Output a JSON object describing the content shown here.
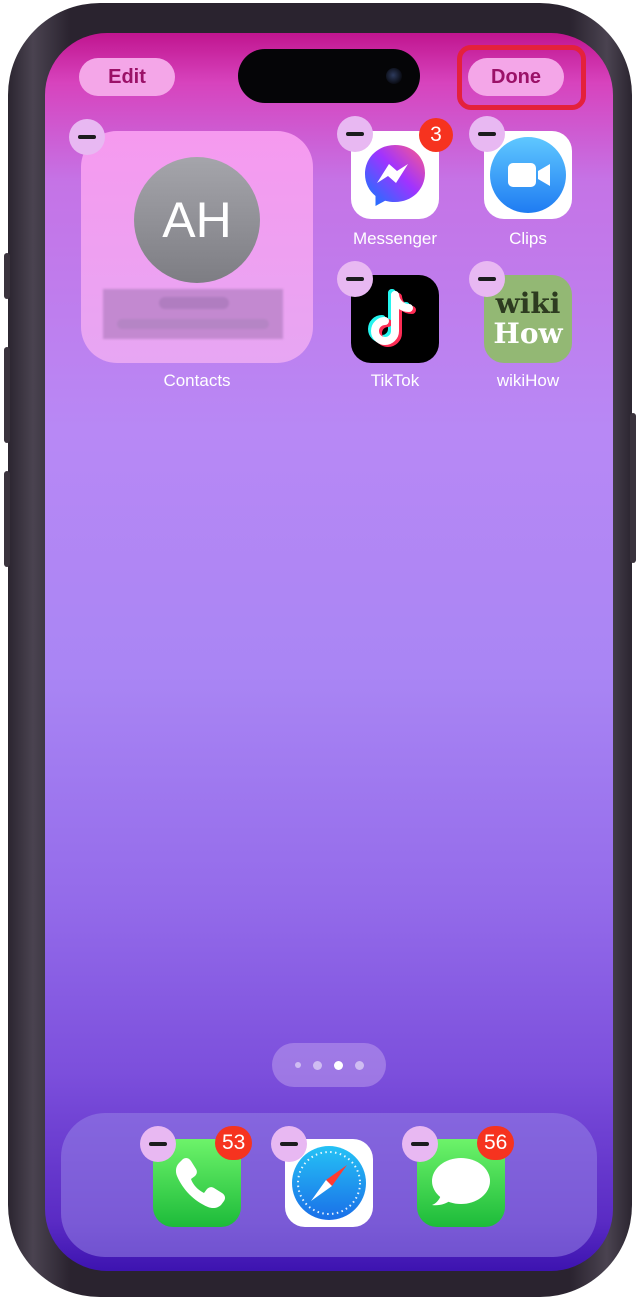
{
  "header": {
    "edit_label": "Edit",
    "done_label": "Done"
  },
  "widget": {
    "initials": "AH",
    "label": "Contacts"
  },
  "apps": {
    "messenger": {
      "label": "Messenger",
      "badge": "3",
      "icon": "messenger-icon"
    },
    "clips": {
      "label": "Clips",
      "icon": "clips-camera-icon"
    },
    "tiktok": {
      "label": "TikTok",
      "icon": "tiktok-icon"
    },
    "wikihow": {
      "label": "wikiHow",
      "icon_text_top": "wiki",
      "icon_text_bottom": "How"
    }
  },
  "dock": {
    "phone": {
      "badge": "53",
      "icon": "phone-icon"
    },
    "safari": {
      "icon": "safari-compass-icon"
    },
    "messages": {
      "badge": "56",
      "icon": "messages-icon"
    }
  },
  "page_indicator": {
    "current": 3,
    "total": 4
  },
  "colors": {
    "badge": "#f6331f",
    "pill": "#f4a6e8",
    "pill_text": "#9b1168",
    "highlight": "#e4213c"
  }
}
